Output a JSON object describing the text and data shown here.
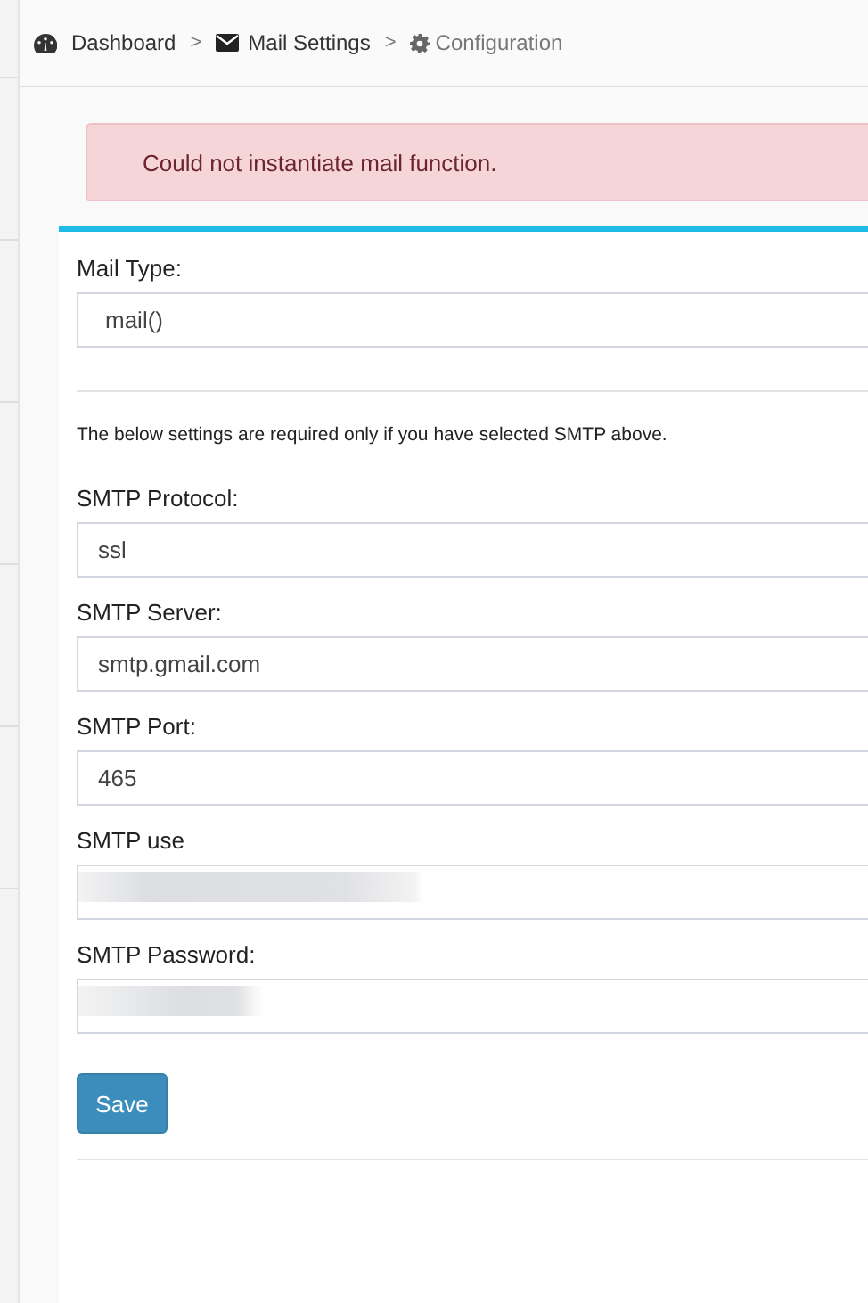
{
  "breadcrumb": [
    {
      "label": "Dashboard"
    },
    {
      "separator": ">",
      "label": "Mail Settings"
    },
    {
      "separator": ">",
      "label": "Configuration"
    }
  ],
  "alert": {
    "message": "Could not instantiate mail function."
  },
  "mail_type": {
    "label": "Mail Type:",
    "value": "mail()"
  },
  "note": "The below settings are required only if you have selected SMTP above.",
  "fields": [
    {
      "label": "SMTP Protocol:",
      "value": "ssl",
      "redacted": false
    },
    {
      "label": "SMTP Server:",
      "value": "smtp.gmail.com",
      "redacted": false
    },
    {
      "label": "SMTP Port:",
      "value": "465",
      "redacted": false
    },
    {
      "label": "SMTP use",
      "redacted": true
    },
    {
      "label": "SMTP Password:",
      "redacted": true
    }
  ],
  "save_button": "Save"
}
